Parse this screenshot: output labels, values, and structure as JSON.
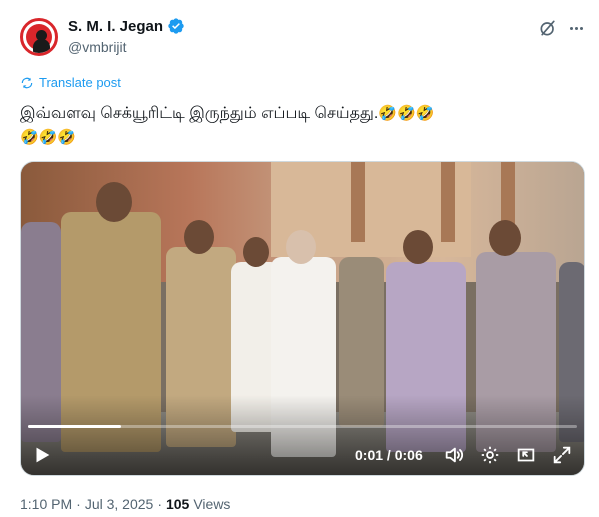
{
  "author": {
    "display_name": "S. M. I. Jegan",
    "handle": "@vmbrijit",
    "verified": true,
    "avatar_icon": "avatar-silhouette-icon",
    "avatar_color": "#d9262b"
  },
  "header_actions": {
    "grok_icon": "grok-slash-icon",
    "more_icon": "more-dots-icon"
  },
  "translate": {
    "label": "Translate post"
  },
  "post": {
    "text": "இவ்வளவு செக்யூரிட்டி இருந்தும் எப்படி செய்தது.",
    "emoji_line1": "🤣🤣🤣",
    "emoji_line2": "🤣🤣🤣"
  },
  "video": {
    "current_time": "0:01",
    "separator": " / ",
    "duration": "0:06",
    "progress": 0.17,
    "icons": [
      "play-icon",
      "volume-icon",
      "settings-icon",
      "pip-icon",
      "fullscreen-icon"
    ]
  },
  "meta": {
    "time": "1:10 PM",
    "dot": "·",
    "date": "Jul 3, 2025",
    "dot2": "·",
    "views_count": "105",
    "views_label": "Views"
  },
  "colors": {
    "accent": "#1d9bf0",
    "text": "#0f1419",
    "secondary": "#536471"
  }
}
